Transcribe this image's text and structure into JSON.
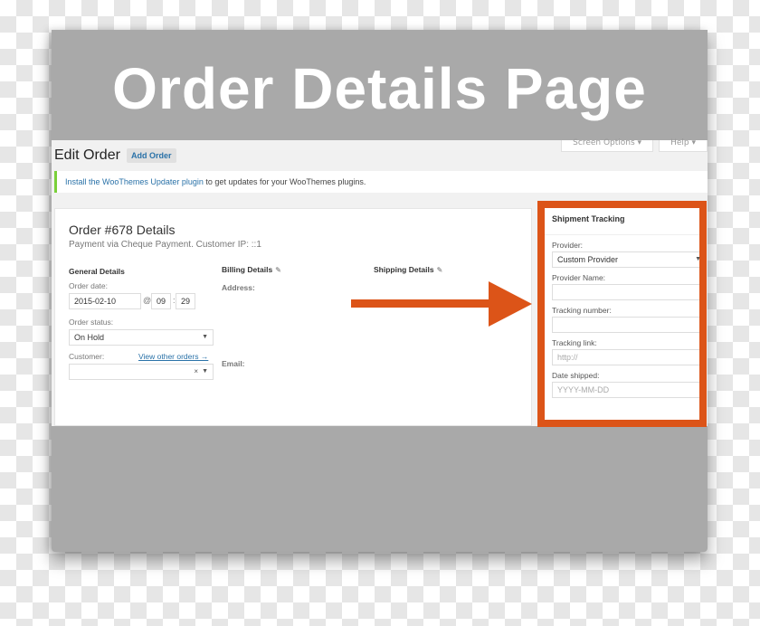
{
  "banner": {
    "title": "Order Details Page"
  },
  "screen_meta": {
    "screen_options": "Screen Options ▾",
    "help": "Help ▾"
  },
  "header": {
    "title": "Edit Order",
    "add_order": "Add Order"
  },
  "notice": {
    "link_text": "Install the WooThemes Updater plugin",
    "text": " to get updates for your WooThemes plugins."
  },
  "order": {
    "title": "Order #678 Details",
    "subtitle": "Payment via Cheque Payment. Customer IP: ::1",
    "general": {
      "heading": "General Details",
      "order_date_label": "Order date:",
      "date": "2015-02-10",
      "at": "@",
      "hour": "09",
      "colon": ":",
      "minute": "29",
      "status_label": "Order status:",
      "status": "On Hold",
      "customer_label": "Customer:",
      "view_other_orders": "View other orders →",
      "customer_value": ""
    },
    "billing": {
      "heading": "Billing Details",
      "address_label": "Address:",
      "email_label": "Email:"
    },
    "shipping": {
      "heading": "Shipping Details"
    }
  },
  "tracking": {
    "heading": "Shipment Tracking",
    "provider_label": "Provider:",
    "provider": "Custom Provider",
    "provider_name_label": "Provider Name:",
    "provider_name": "",
    "tracking_number_label": "Tracking number:",
    "tracking_number": "",
    "tracking_link_label": "Tracking link:",
    "tracking_link_placeholder": "http://",
    "date_shipped_label": "Date shipped:",
    "date_shipped_placeholder": "YYYY-MM-DD"
  },
  "icons": {
    "pencil": "✎",
    "caret": "▼",
    "clear": "×"
  },
  "colors": {
    "highlight": "#dc5418",
    "link": "#2a72a8",
    "notice_border": "#7ad03a",
    "frame": "#a9a9a9"
  }
}
